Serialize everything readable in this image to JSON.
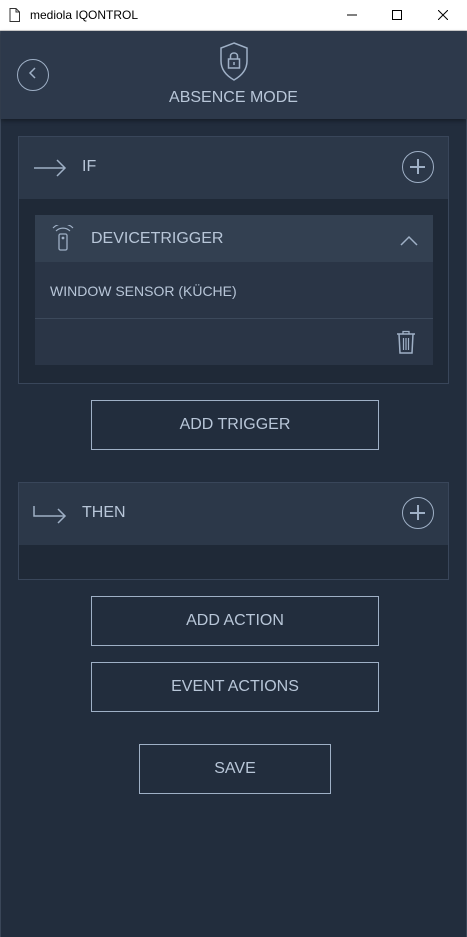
{
  "window": {
    "title": "mediola IQONTROL",
    "controls": [
      "minimize-icon",
      "maximize-icon",
      "close-icon"
    ]
  },
  "header": {
    "title": "ABSENCE MODE",
    "icon": "shield-lock-icon",
    "back_icon": "back-arrow-icon"
  },
  "if_section": {
    "label": "IF",
    "icon": "arrow-right-icon",
    "add_icon": "plus-circle-icon",
    "trigger": {
      "type_label": "DEVICETRIGGER",
      "icon": "remote-signal-icon",
      "device": "WINDOW SENSOR (KÜCHE)",
      "collapse_icon": "chevron-up-icon",
      "delete_icon": "trash-icon"
    }
  },
  "add_trigger_label": "ADD TRIGGER",
  "then_section": {
    "label": "THEN",
    "icon": "arrow-turn-right-icon",
    "add_icon": "plus-circle-icon"
  },
  "add_action_label": "ADD ACTION",
  "event_actions_label": "EVENT ACTIONS",
  "save_label": "SAVE",
  "colors": {
    "background": "#222d3d",
    "header": "#2d394b",
    "accent": "#9fb0c6",
    "text": "#b8c6d8"
  }
}
